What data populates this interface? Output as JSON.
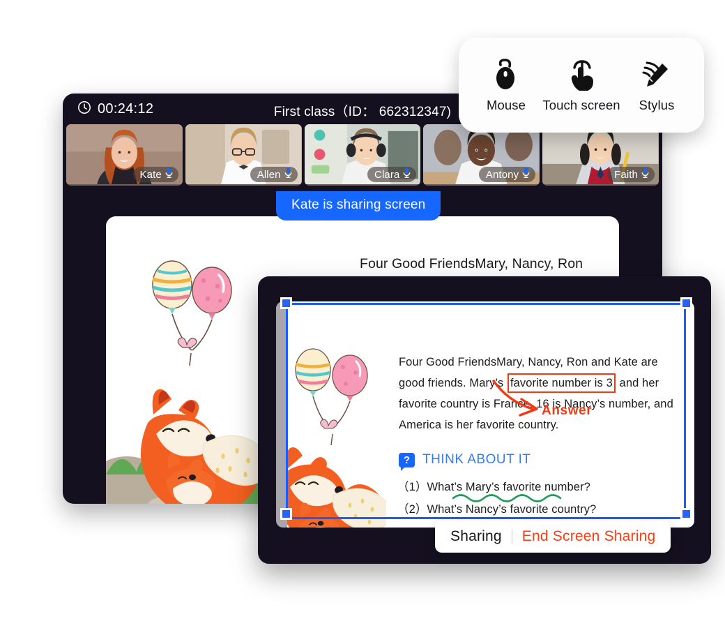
{
  "mode_bar": {
    "items": [
      {
        "label": "Mouse",
        "icon": "mouse-icon"
      },
      {
        "label": "Touch screen",
        "icon": "touch-hand-icon"
      },
      {
        "label": "Stylus",
        "icon": "stylus-pen-icon"
      }
    ]
  },
  "meeting": {
    "timer": "00:24:12",
    "clock_icon": "clock-icon",
    "title": "First class（ID： 662312347)",
    "participants": [
      {
        "name": "Kate",
        "mic_icon": "microphone-icon"
      },
      {
        "name": "Allen",
        "mic_icon": "microphone-icon"
      },
      {
        "name": "Clara",
        "mic_icon": "microphone-icon"
      },
      {
        "name": "Antony",
        "mic_icon": "microphone-icon"
      },
      {
        "name": "Faith",
        "mic_icon": "microphone-icon"
      }
    ],
    "share_banner": "Kate is sharing screen"
  },
  "lesson": {
    "paragraph_line1": "Four Good FriendsMary, Nancy, Ron and Kate are",
    "para_part1": "good friends. Mary’s ",
    "para_highlight": "favorite number is 3",
    "para_part2": " and her",
    "para_line3": "favorite country is France. 16 is Nancy’s number, and",
    "para_line4": "America is her favorite country.",
    "annotation_label": "Answer",
    "think_badge": "?",
    "think_title": "THINK ABOUT IT",
    "questions": [
      "（1）What’s Mary’s favorite number?",
      "（2）What’s Nancy’s favorite country?"
    ]
  },
  "share_bar": {
    "status": "Sharing",
    "end_label": "End Screen Sharing"
  },
  "colors": {
    "accent_blue": "#1667ff",
    "selection_blue": "#1a5cff",
    "annotation_red": "#f03a12",
    "end_red": "#ff3b11",
    "window_dark": "#14101f",
    "underline_green": "#1f9d55"
  }
}
